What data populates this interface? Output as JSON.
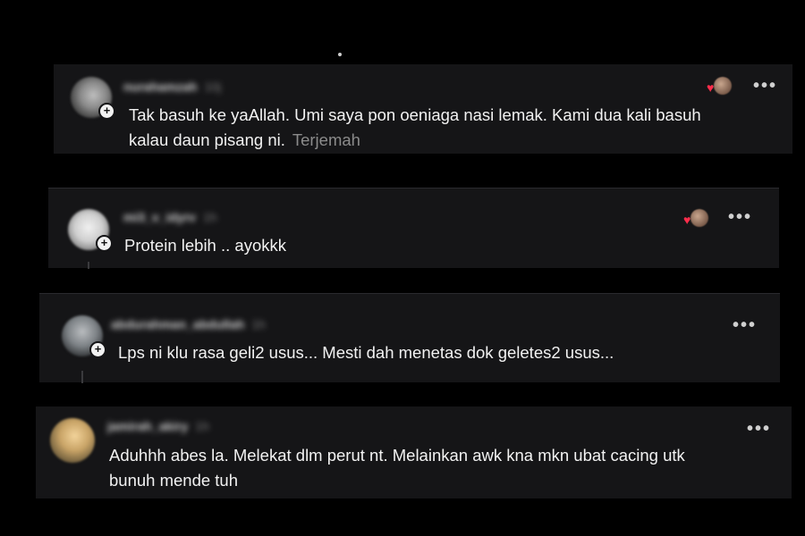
{
  "comments": [
    {
      "username": "nurahamzah",
      "time": "10j",
      "text": "Tak basuh ke yaAllah. Umi saya pon oeniaga nasi lemak. Kami dua kali basuh",
      "text2": "kalau daun pisang ni.",
      "translate_label": "Terjemah",
      "has_reaction": true,
      "avatar_color": "#9a9a9a"
    },
    {
      "username": "mi3_v_idyrv",
      "time": "1h",
      "text": "Protein lebih .. ayokkk",
      "has_reaction": true,
      "avatar_color": "#d8d8d8"
    },
    {
      "username": "abdurahman_abdullah",
      "time": "1h",
      "text": "Lps ni klu rasa geli2 usus... Mesti dah menetas dok geletes2 usus...",
      "has_reaction": false,
      "avatar_color": "#7a7f83"
    },
    {
      "username": "jamirah_akiry",
      "time": "1h",
      "text": "Aduhhh abes la. Melekat dlm perut nt. Melainkan awk kna mkn ubat cacing utk",
      "text2": "bunuh mende tuh",
      "has_reaction": false,
      "avatar_color": "#c7a36a"
    }
  ],
  "more_label": "•••",
  "avatar_plus": "+",
  "heart": "♥",
  "colors": {
    "background": "#000000",
    "card": "#151517",
    "text": "#f2f2f2",
    "muted": "#8b8b8b",
    "heart": "#ff2d4b"
  }
}
